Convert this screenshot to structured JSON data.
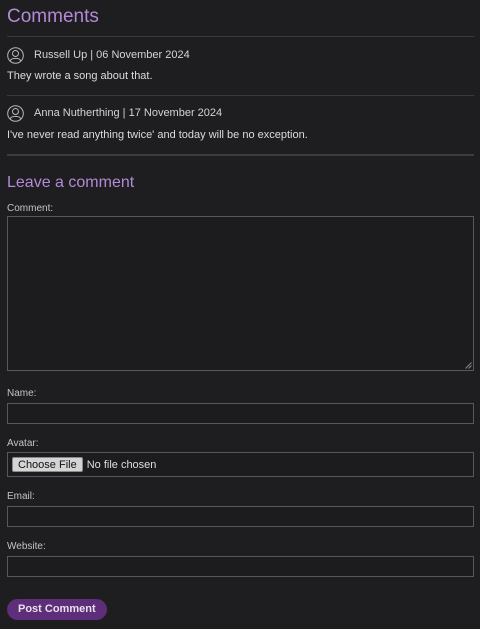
{
  "comments_section": {
    "heading": "Comments",
    "items": [
      {
        "meta": "Russell Up | 06 November 2024",
        "text": "They wrote a song about that."
      },
      {
        "meta": "Anna Nutherthing | 17 November 2024",
        "text": "I've never read anything twice' and today will be no exception."
      }
    ]
  },
  "form": {
    "heading": "Leave a comment",
    "comment_label": "Comment:",
    "name_label": "Name:",
    "avatar_label": "Avatar:",
    "file_button_label": "Choose File",
    "file_status": "No file chosen",
    "email_label": "Email:",
    "website_label": "Website:",
    "submit_label": "Post Comment"
  },
  "colors": {
    "background": "#1e1e20",
    "heading": "#b28ad6",
    "button": "#5e2e7a"
  },
  "icons": {
    "avatar": "user-avatar-icon"
  }
}
